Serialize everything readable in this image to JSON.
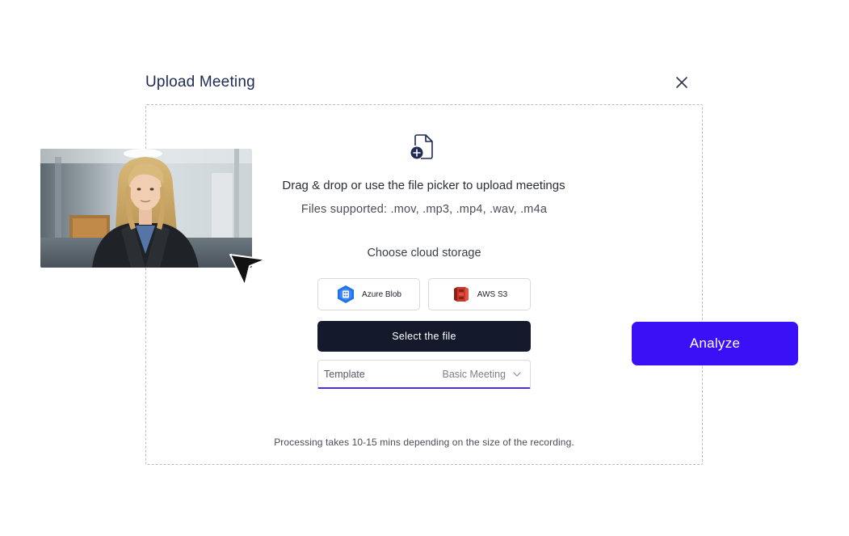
{
  "dialog": {
    "title": "Upload Meeting",
    "drag_text": "Drag & drop or use the file picker to upload meetings",
    "supported_text": "Files supported: .mov, .mp3, .mp4, .wav, .m4a",
    "cloud_label": "Choose cloud storage",
    "storage_options": [
      {
        "label": "Azure Blob",
        "icon": "azure-blob-icon"
      },
      {
        "label": "AWS S3",
        "icon": "aws-s3-icon"
      }
    ],
    "select_button": "Select the file",
    "template": {
      "label": "Template",
      "value": "Basic Meeting"
    },
    "processing_note": "Processing takes 10-15 mins depending on the size of the recording."
  },
  "analyze_button": "Analyze",
  "colors": {
    "title": "#1f2a55",
    "select_button_bg": "#141a2b",
    "analyze_bg": "#3b10f7",
    "template_underline": "#4b2bf0",
    "dashed_border": "#b9bcc3"
  },
  "icons": {
    "close": "close-icon",
    "file_upload": "file-add-icon",
    "chevron": "chevron-down-icon",
    "cursor": "pointer-cursor-icon"
  }
}
